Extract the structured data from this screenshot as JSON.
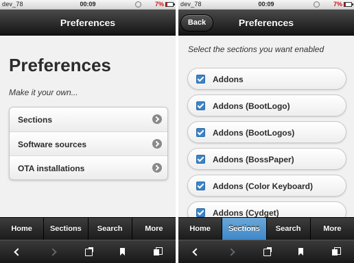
{
  "status_bar": {
    "carrier": "dev_78",
    "time": "00:09",
    "battery": "7%"
  },
  "left_screen": {
    "header_title": "Preferences",
    "page_title": "Preferences",
    "subtitle": "Make it your own...",
    "menu": [
      {
        "label": "Sections"
      },
      {
        "label": "Software sources"
      },
      {
        "label": "OTA installations"
      }
    ]
  },
  "right_screen": {
    "header_title": "Preferences",
    "back_label": "Back",
    "instruction": "Select the sections you want enabled",
    "sections": [
      {
        "label": "Addons",
        "checked": true
      },
      {
        "label": "Addons (BootLogo)",
        "checked": true
      },
      {
        "label": "Addons (BootLogos)",
        "checked": true
      },
      {
        "label": "Addons (BossPaper)",
        "checked": true
      },
      {
        "label": "Addons (Color Keyboard)",
        "checked": true
      },
      {
        "label": "Addons (Cydget)",
        "checked": true
      }
    ]
  },
  "tab_bar": {
    "tabs": [
      {
        "label": "Home"
      },
      {
        "label": "Sections"
      },
      {
        "label": "Search"
      },
      {
        "label": "More"
      }
    ],
    "active_left": "none",
    "active_right": "Sections",
    "active_color": "#4b8fcc"
  },
  "toolbar": {
    "icons": [
      "back-arrow-icon",
      "forward-arrow-icon",
      "share-icon",
      "bookmark-icon",
      "pages-icon"
    ]
  }
}
